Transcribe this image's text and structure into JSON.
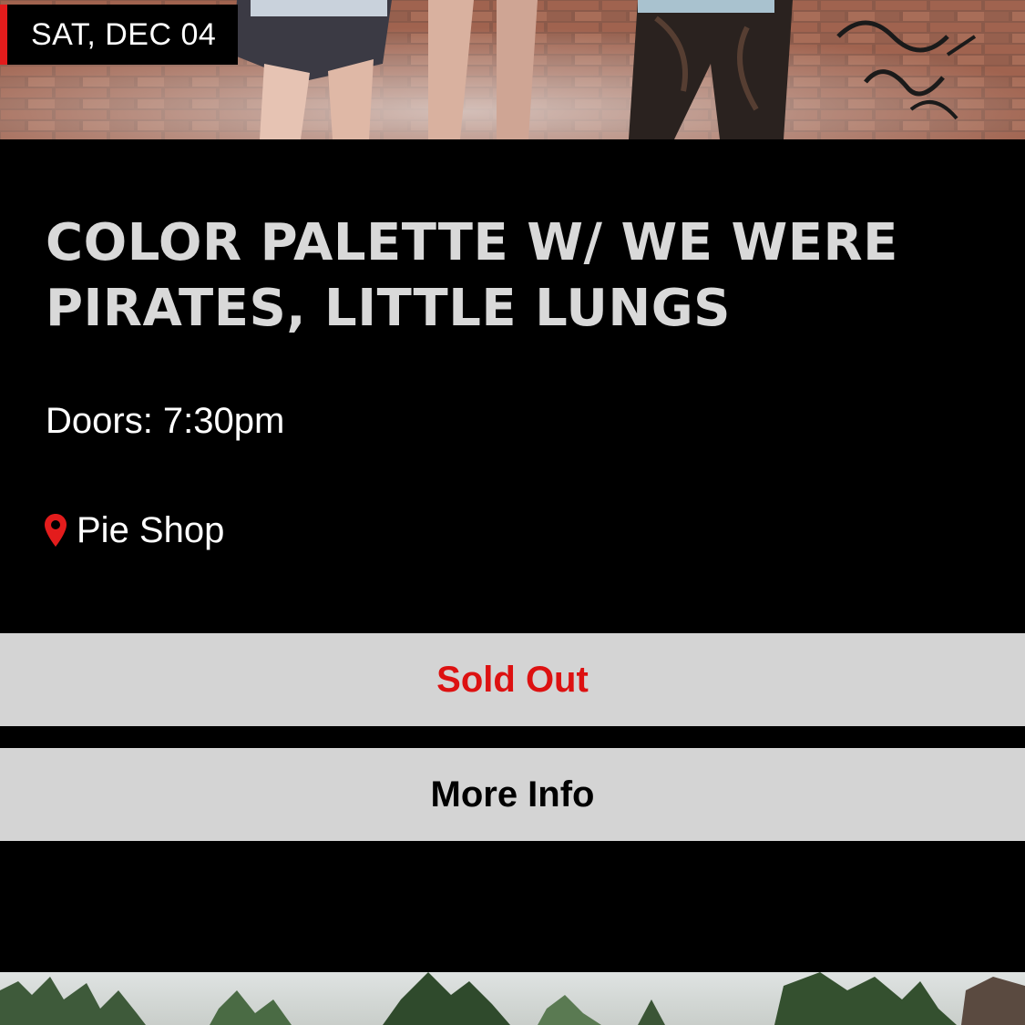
{
  "event": {
    "date_label": "SAT, DEC 04",
    "title": "COLOR PALETTE W/ WE WERE PIRATES, LITTLE LUNGS",
    "doors": "Doors: 7:30pm",
    "venue": "Pie Shop"
  },
  "buttons": {
    "status_label": "Sold Out",
    "more_info_label": "More Info"
  },
  "icons": {
    "venue": "location-pin-icon"
  },
  "colors": {
    "accent_red": "#e31c1c",
    "sold_out_text": "#dd1111",
    "button_background": "#d4d4d4",
    "card_background": "#000000",
    "title_text": "#d9d9d9"
  }
}
